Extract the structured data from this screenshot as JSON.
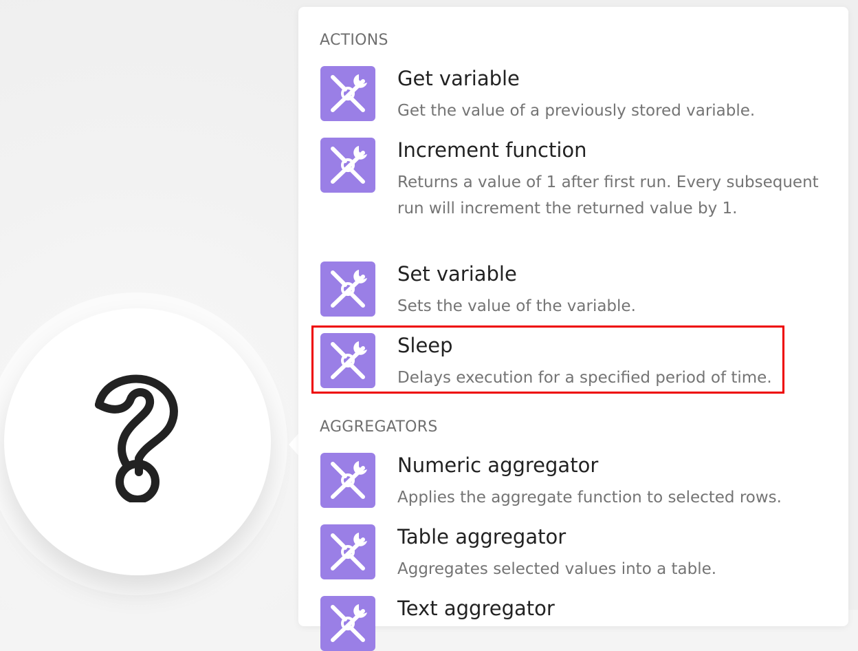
{
  "module": {
    "icon": "question-mark-icon"
  },
  "panel": {
    "sections": [
      {
        "title": "ACTIONS",
        "items": [
          {
            "title": "Get variable",
            "desc": "Get the value of a previously stored variable.",
            "icon": "tools-icon"
          },
          {
            "title": "Increment function",
            "desc": "Returns a value of 1 after first run. Every subsequent run will increment the returned value by 1.",
            "icon": "tools-icon"
          },
          {
            "title": "Set variable",
            "desc": "Sets the value of the variable.",
            "icon": "tools-icon"
          },
          {
            "title": "Sleep",
            "desc": "Delays execution for a specified period of time.",
            "icon": "tools-icon",
            "highlighted": true
          }
        ]
      },
      {
        "title": "AGGREGATORS",
        "items": [
          {
            "title": "Numeric aggregator",
            "desc": "Applies the aggregate function to selected rows.",
            "icon": "tools-icon"
          },
          {
            "title": "Table aggregator",
            "desc": "Aggregates selected values into a table.",
            "icon": "tools-icon"
          },
          {
            "title": "Text aggregator",
            "desc": "",
            "icon": "tools-icon"
          }
        ]
      }
    ]
  },
  "colors": {
    "icon_bg": "#9a7fe6",
    "highlight": "#ee0000"
  }
}
